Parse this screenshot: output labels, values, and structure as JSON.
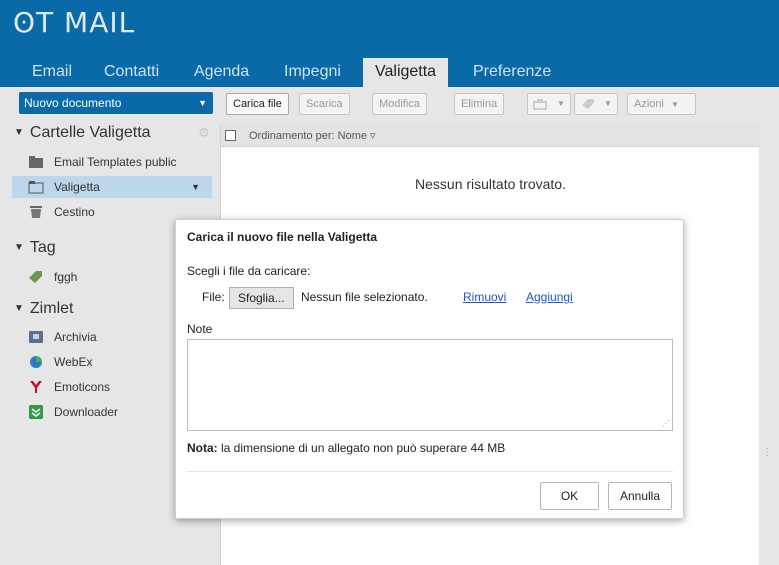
{
  "app": {
    "logo": "ʘT MAIL"
  },
  "tabs": [
    {
      "label": "Email"
    },
    {
      "label": "Contatti"
    },
    {
      "label": "Agenda"
    },
    {
      "label": "Impegni"
    },
    {
      "label": "Valigetta"
    },
    {
      "label": "Preferenze"
    }
  ],
  "toolbar": {
    "new_doc": "Nuovo documento",
    "upload": "Carica file",
    "download": "Scarica",
    "edit": "Modifica",
    "delete": "Elimina",
    "actions": "Azioni"
  },
  "sidebar": {
    "briefcase_header": "Cartelle Valigetta",
    "folders": [
      {
        "label": "Email Templates public",
        "icon": "folder-icon"
      },
      {
        "label": "Valigetta",
        "icon": "folder-icon"
      },
      {
        "label": "Cestino",
        "icon": "trash-icon"
      }
    ],
    "tag_header": "Tag",
    "tags": [
      {
        "label": "fggh",
        "icon": "tag-icon"
      }
    ],
    "zimlet_header": "Zimlet",
    "zimlets": [
      {
        "label": "Archivia",
        "icon": "archive-icon"
      },
      {
        "label": "WebEx",
        "icon": "webex-icon"
      },
      {
        "label": "Emoticons",
        "icon": "emoticons-icon"
      },
      {
        "label": "Downloader",
        "icon": "downloader-icon"
      }
    ]
  },
  "content": {
    "sort_label": "Ordinamento per: Nome ▿",
    "empty_message": "Nessun risultato trovato."
  },
  "dialog": {
    "title": "Carica il nuovo file nella Valigetta",
    "choose_label": "Scegli i file da caricare:",
    "file_label": "File:",
    "browse_button": "Sfoglia...",
    "no_file": "Nessun file selezionato.",
    "remove_link": "Rimuovi",
    "add_link": "Aggiungi",
    "note_label": "Note",
    "note_value": "",
    "notice_bold": "Nota:",
    "notice_text": " la dimensione di un allegato non può superare 44 MB",
    "ok_button": "OK",
    "cancel_button": "Annulla"
  },
  "colors": {
    "brand": "#0a6aa8",
    "selected": "#bcd6ea",
    "link": "#1f56c9"
  }
}
